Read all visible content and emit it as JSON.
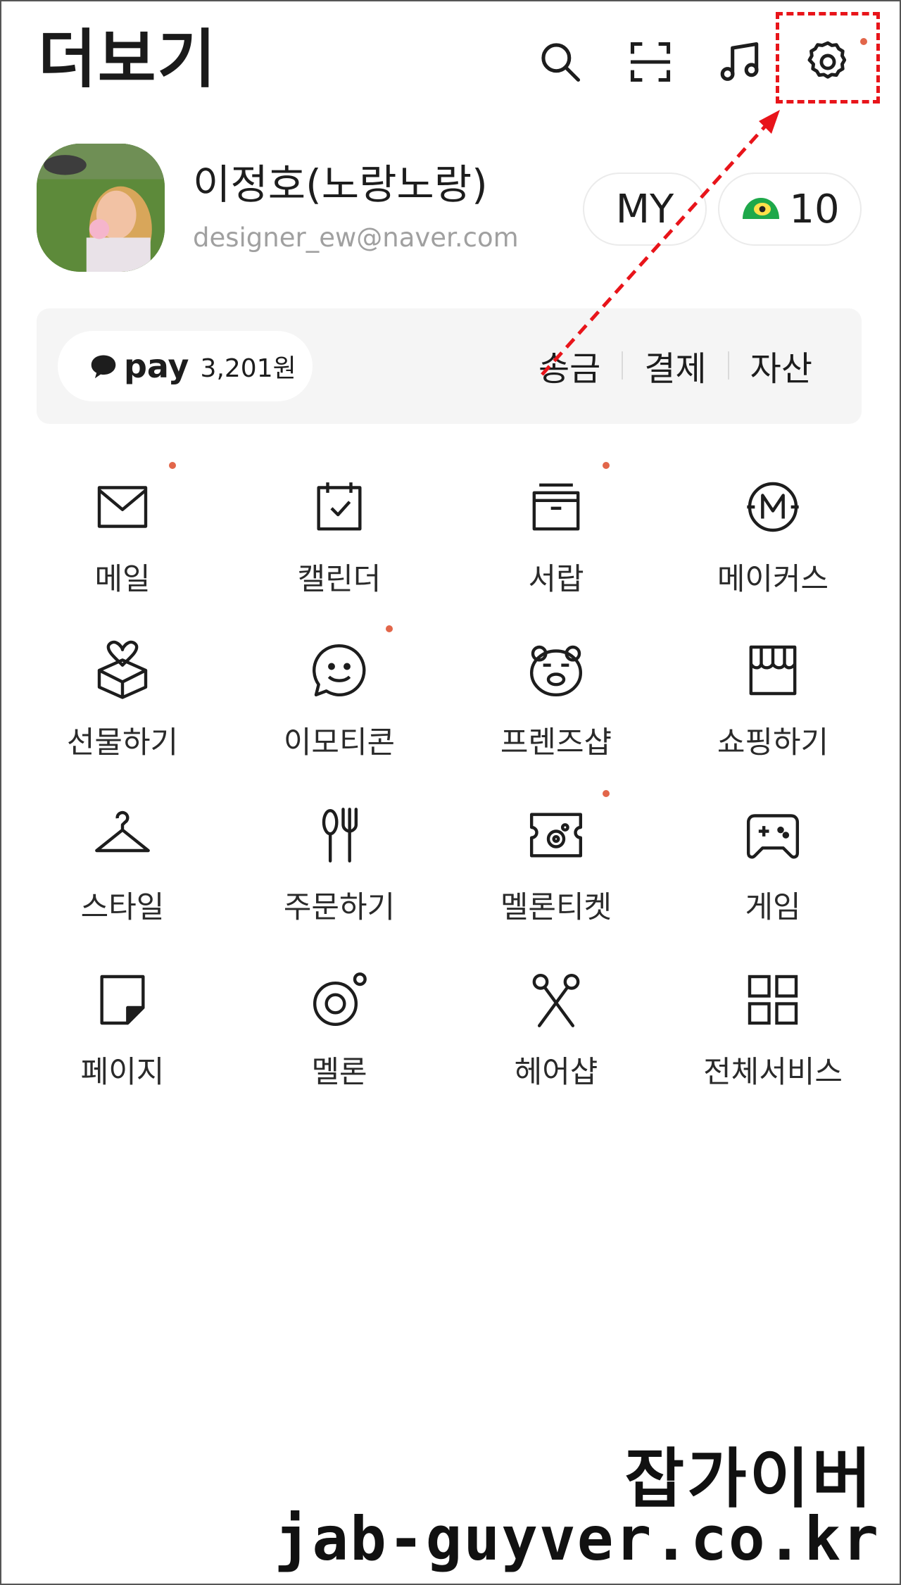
{
  "header": {
    "title": "더보기",
    "icons": [
      "search-icon",
      "scan-icon",
      "music-icon",
      "settings-icon"
    ]
  },
  "profile": {
    "name": "이정호(노랑노랑)",
    "email": "designer_ew@naver.com",
    "my_button": "MY",
    "points": "10"
  },
  "pay": {
    "logo": "pay",
    "balance": "3,201원",
    "actions": [
      "송금",
      "결제",
      "자산"
    ]
  },
  "services": [
    {
      "label": "메일",
      "icon": "mail-icon",
      "badge": true
    },
    {
      "label": "캘린더",
      "icon": "calendar-icon",
      "badge": false
    },
    {
      "label": "서랍",
      "icon": "drawer-icon",
      "badge": true
    },
    {
      "label": "메이커스",
      "icon": "makers-icon",
      "badge": false
    },
    {
      "label": "선물하기",
      "icon": "gift-icon",
      "badge": false
    },
    {
      "label": "이모티콘",
      "icon": "emoticon-icon",
      "badge": true
    },
    {
      "label": "프렌즈샵",
      "icon": "friends-shop-icon",
      "badge": false
    },
    {
      "label": "쇼핑하기",
      "icon": "shopping-icon",
      "badge": false
    },
    {
      "label": "스타일",
      "icon": "hanger-icon",
      "badge": false
    },
    {
      "label": "주문하기",
      "icon": "order-icon",
      "badge": false
    },
    {
      "label": "멜론티켓",
      "icon": "ticket-icon",
      "badge": true
    },
    {
      "label": "게임",
      "icon": "game-icon",
      "badge": false
    },
    {
      "label": "페이지",
      "icon": "page-icon",
      "badge": false
    },
    {
      "label": "멜론",
      "icon": "melon-icon",
      "badge": false
    },
    {
      "label": "헤어샵",
      "icon": "scissors-icon",
      "badge": false
    },
    {
      "label": "전체서비스",
      "icon": "all-services-icon",
      "badge": false
    }
  ],
  "watermark": {
    "title": "잡가이버",
    "url": "jab-guyver.co.kr"
  },
  "colors": {
    "badge_dot": "#e2664a",
    "highlight": "#e8141a",
    "pay_bar_bg": "#f5f5f5",
    "points_icon": "#1ea84a"
  }
}
